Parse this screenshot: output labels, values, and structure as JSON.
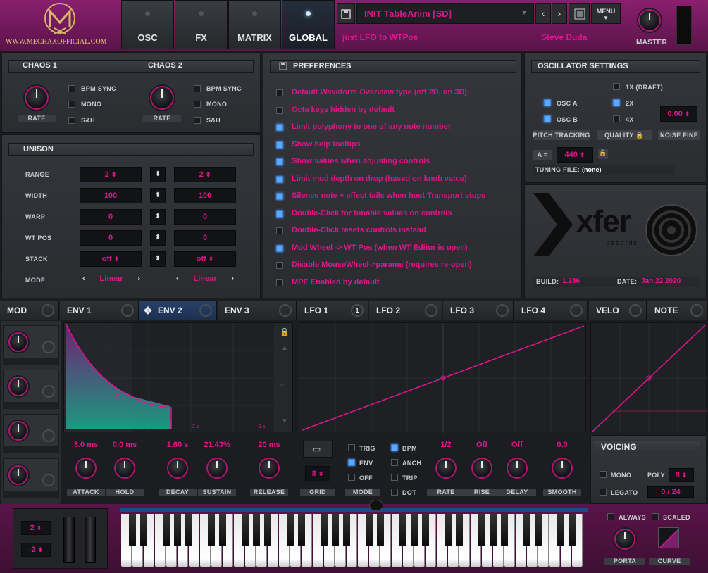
{
  "logo": {
    "site": "WWW.MECHAXOFFICIAL.COM"
  },
  "topnav": {
    "tabs": [
      "OSC",
      "FX",
      "MATRIX",
      "GLOBAL"
    ],
    "active": "GLOBAL"
  },
  "preset": {
    "name": "INIT TableAnim [SD]",
    "description": "just LFO to WTPos",
    "author": "Steve Duda",
    "menu": "MENU",
    "master": "MASTER"
  },
  "chaos": {
    "c1": "CHAOS 1",
    "c2": "CHAOS 2",
    "rate": "RATE",
    "opts": [
      "BPM SYNC",
      "MONO",
      "S&H"
    ]
  },
  "unison": {
    "title": "UNISON",
    "rows": [
      {
        "label": "RANGE",
        "a": "2",
        "b": "2"
      },
      {
        "label": "WIDTH",
        "a": "100",
        "b": "100"
      },
      {
        "label": "WARP",
        "a": "0",
        "b": "0"
      },
      {
        "label": "WT POS",
        "a": "0",
        "b": "0"
      },
      {
        "label": "STACK",
        "a": "off",
        "b": "off"
      },
      {
        "label": "MODE",
        "a": "Linear",
        "b": "Linear"
      }
    ]
  },
  "preferences": {
    "title": "PREFERENCES",
    "items": [
      {
        "text": "Default Waveform Overview type (off 2D, on 3D)",
        "on": false
      },
      {
        "text": "Octa keys hidden by default",
        "on": false
      },
      {
        "text": "Limit polyphony to one of any note number",
        "on": true
      },
      {
        "text": "Show help tooltips",
        "on": true
      },
      {
        "text": "Show values when adjusting controls",
        "on": true
      },
      {
        "text": "Limit mod depth on drop (based on knob value)",
        "on": true
      },
      {
        "text": "Silence note + effect tails when host Transport stops",
        "on": true
      },
      {
        "text": "Double-Click for tunable values on controls",
        "on": true
      },
      {
        "text": "Double-Click resets controls instead",
        "on": false
      },
      {
        "text": "Mod Wheel -> WT Pos (when WT Editor is open)",
        "on": true
      },
      {
        "text": "Disable MouseWheel->params (requires re-open)",
        "on": false
      },
      {
        "text": "MPE Enabled by default",
        "on": false
      }
    ]
  },
  "osc_settings": {
    "title": "OSCILLATOR SETTINGS",
    "osc_a": "OSC A",
    "osc_b": "OSC B",
    "draft": "1X (DRAFT)",
    "x2": "2X",
    "x4": "4X",
    "value": "0.00",
    "pitch": "PITCH TRACKING",
    "quality": "QUALITY",
    "noise": "NOISE FINE",
    "a_label": "A =",
    "a_value": "440",
    "tuning_label": "TUNING FILE:",
    "tuning_value": "(none)",
    "build_label": "BUILD:",
    "build_value": "1.286",
    "date_label": "DATE:",
    "date_value": "Jan 22 2020",
    "brand": "xfer",
    "brand_sub": "records"
  },
  "modtabs": {
    "mod": "MOD",
    "env1": "ENV 1",
    "env2": "ENV 2",
    "env3": "ENV 3",
    "lfo1": "LFO 1",
    "lfo1_count": "1",
    "lfo2": "LFO 2",
    "lfo3": "LFO 3",
    "lfo4": "LFO 4",
    "velo": "VELO",
    "note": "NOTE"
  },
  "env": {
    "ticks": [
      "2 s",
      "3 s"
    ],
    "vals": [
      "3.0 ms",
      "0.0 ms",
      "1.60 s",
      "21.43%",
      "20 ms"
    ],
    "labels": [
      "ATTACK",
      "HOLD",
      "DECAY",
      "SUSTAIN",
      "RELEASE"
    ]
  },
  "lfo": {
    "grid": "GRID",
    "grid_val": "8",
    "trig": "TRIG",
    "env": "ENV",
    "off": "OFF",
    "mode": "MODE",
    "bpm": "BPM",
    "anch": "ANCH",
    "trip": "TRIP",
    "dot": "DOT",
    "vals": [
      "1/2",
      "Off",
      "Off",
      "0.0"
    ],
    "labels": [
      "RATE",
      "RISE",
      "DELAY",
      "SMOOTH"
    ]
  },
  "voicing": {
    "title": "VOICING",
    "mono": "MONO",
    "poly": "POLY",
    "poly_val": "8",
    "legato": "LEGATO",
    "legato_val": "0 / 24",
    "always": "ALWAYS",
    "scaled": "SCALED",
    "porta": "PORTA",
    "curve": "CURVE"
  },
  "bend": {
    "up": "2",
    "down": "-2"
  },
  "colors": {
    "accent": "#e0158f",
    "check": "#5fa8ff"
  }
}
